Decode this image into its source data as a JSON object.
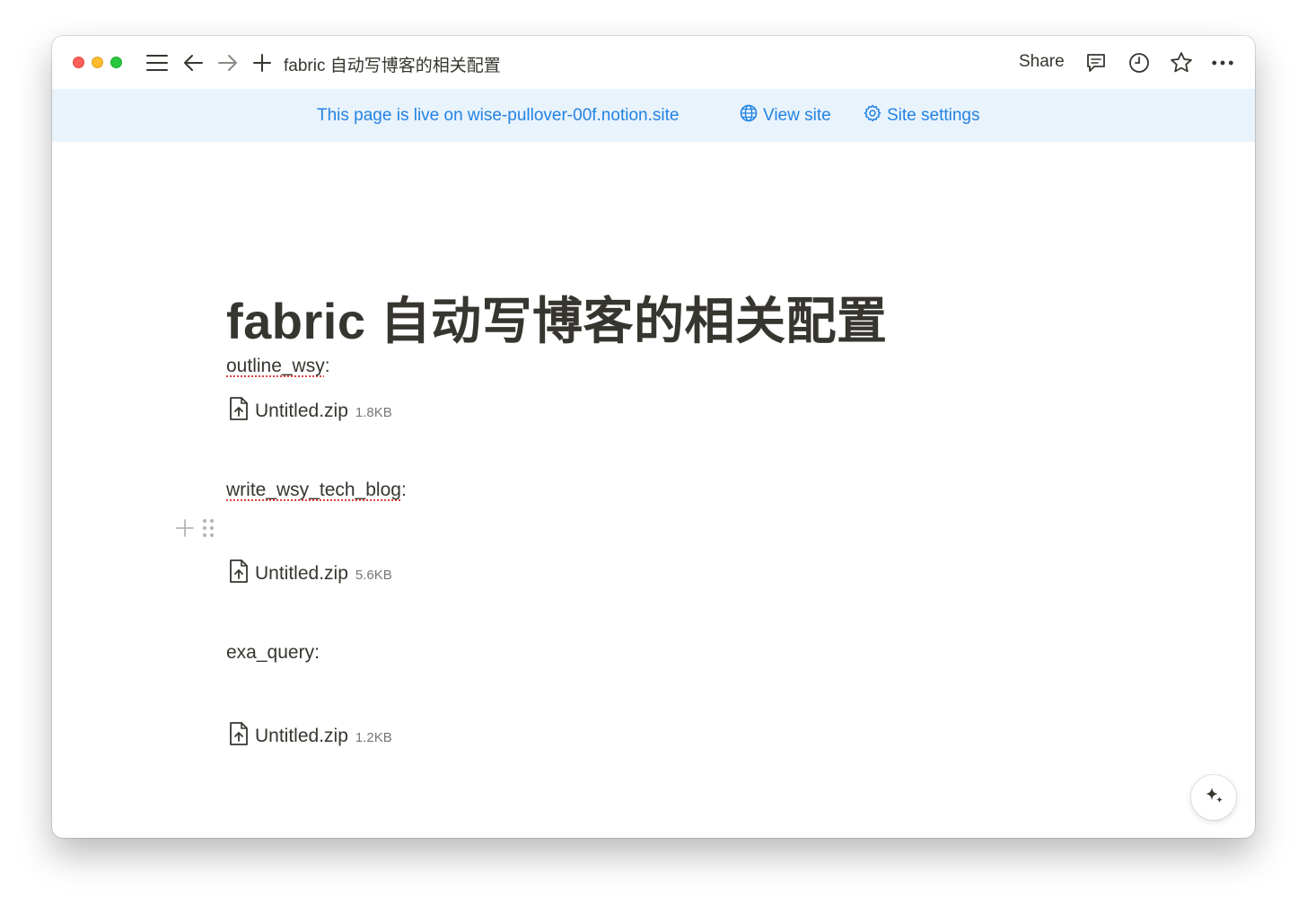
{
  "window": {
    "controls": [
      "close",
      "minimize",
      "zoom"
    ]
  },
  "toolbar": {
    "page_title": "fabric 自动写博客的相关配置",
    "share_label": "Share",
    "icons": [
      "menu-icon",
      "back-arrow-icon",
      "forward-arrow-icon",
      "plus-icon",
      "comment-icon",
      "history-icon",
      "star-icon",
      "more-icon"
    ]
  },
  "banner": {
    "text": "This page is live on wise-pullover-00f.notion.site",
    "view_site_label": "View site",
    "site_settings_label": "Site settings"
  },
  "page": {
    "title": "fabric 自动写博客的相关配置",
    "blocks": [
      {
        "type": "text",
        "name": "outline_wsy",
        "suffix": ":"
      },
      {
        "type": "file",
        "name": "Untitled.zip",
        "size": "1.8KB"
      },
      {
        "type": "text",
        "name": "write_wsy_tech_blog",
        "suffix": ":"
      },
      {
        "type": "file",
        "name": "Untitled.zip",
        "size": "5.6KB"
      },
      {
        "type": "text",
        "name": "exa_query",
        "suffix": ":"
      },
      {
        "type": "file",
        "name": "Untitled.zip",
        "size": "1.2KB"
      }
    ]
  },
  "colors": {
    "accent": "#2383e2",
    "banner_bg": "#e9f3fc",
    "text": "#37352f",
    "muted": "#787774"
  }
}
